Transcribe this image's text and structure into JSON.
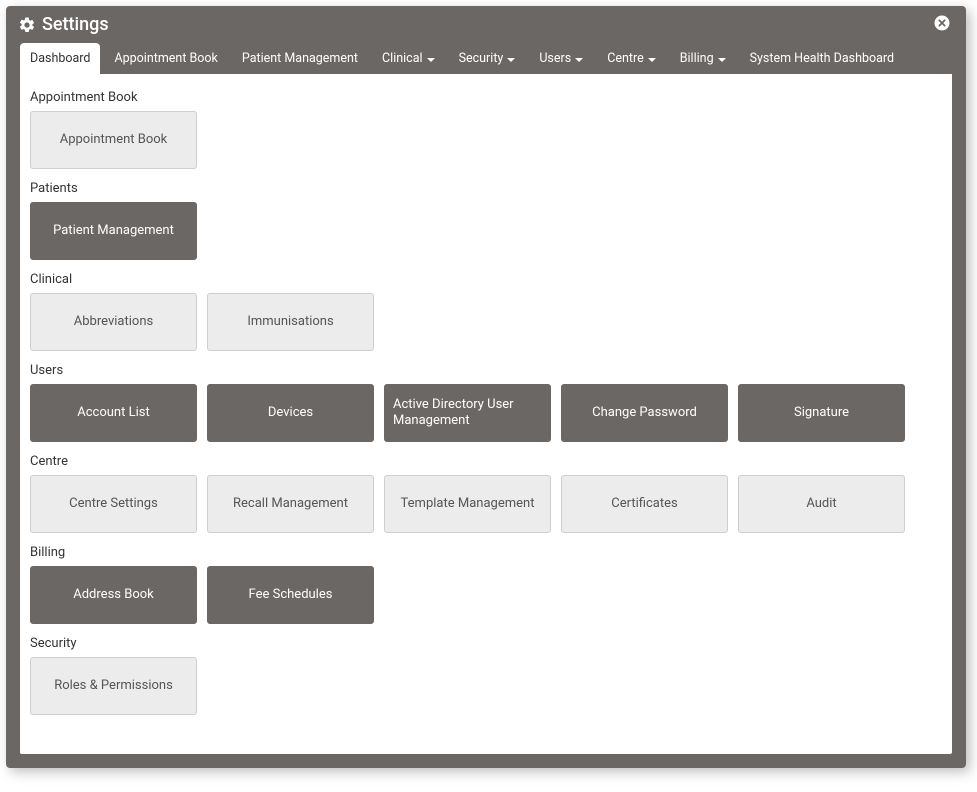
{
  "header": {
    "title": "Settings"
  },
  "nav": [
    {
      "label": "Dashboard",
      "active": true,
      "dropdown": false
    },
    {
      "label": "Appointment Book",
      "active": false,
      "dropdown": false
    },
    {
      "label": "Patient Management",
      "active": false,
      "dropdown": false
    },
    {
      "label": "Clinical",
      "active": false,
      "dropdown": true
    },
    {
      "label": "Security",
      "active": false,
      "dropdown": true
    },
    {
      "label": "Users",
      "active": false,
      "dropdown": true
    },
    {
      "label": "Centre",
      "active": false,
      "dropdown": true
    },
    {
      "label": "Billing",
      "active": false,
      "dropdown": true
    },
    {
      "label": "System Health Dashboard",
      "active": false,
      "dropdown": false
    }
  ],
  "sections": [
    {
      "title": "Appointment Book",
      "tiles": [
        {
          "label": "Appointment Book",
          "style": "light",
          "align": "center"
        }
      ]
    },
    {
      "title": "Patients",
      "tiles": [
        {
          "label": "Patient Management",
          "style": "dark",
          "align": "center"
        }
      ]
    },
    {
      "title": "Clinical",
      "tiles": [
        {
          "label": "Abbreviations",
          "style": "light",
          "align": "center"
        },
        {
          "label": "Immunisations",
          "style": "light",
          "align": "center"
        }
      ]
    },
    {
      "title": "Users",
      "tiles": [
        {
          "label": "Account List",
          "style": "dark",
          "align": "center"
        },
        {
          "label": "Devices",
          "style": "dark",
          "align": "center"
        },
        {
          "label": "Active Directory User Management",
          "style": "dark",
          "align": "left"
        },
        {
          "label": "Change Password",
          "style": "dark",
          "align": "center"
        },
        {
          "label": "Signature",
          "style": "dark",
          "align": "center"
        }
      ]
    },
    {
      "title": "Centre",
      "tiles": [
        {
          "label": "Centre Settings",
          "style": "light",
          "align": "center"
        },
        {
          "label": "Recall Management",
          "style": "light",
          "align": "center"
        },
        {
          "label": "Template Management",
          "style": "light",
          "align": "center"
        },
        {
          "label": "Certificates",
          "style": "light",
          "align": "center"
        },
        {
          "label": "Audit",
          "style": "light",
          "align": "center"
        }
      ]
    },
    {
      "title": "Billing",
      "tiles": [
        {
          "label": "Address Book",
          "style": "dark",
          "align": "center"
        },
        {
          "label": "Fee Schedules",
          "style": "dark",
          "align": "center"
        }
      ]
    },
    {
      "title": "Security",
      "tiles": [
        {
          "label": "Roles & Permissions",
          "style": "light",
          "align": "center"
        }
      ]
    }
  ]
}
